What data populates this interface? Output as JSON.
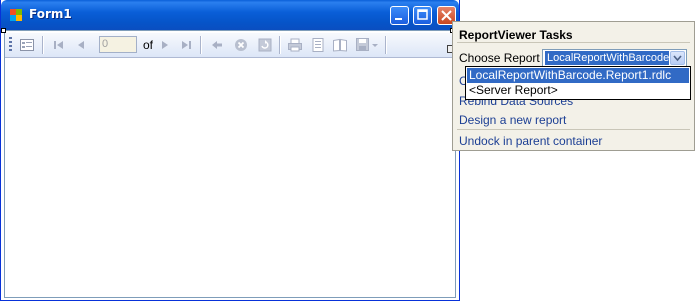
{
  "window": {
    "title": "Form1"
  },
  "toolbar": {
    "page_value": "0",
    "of_label": "of",
    "icons": [
      "document-map-icon",
      "first-page-icon",
      "previous-page-icon",
      "next-page-icon",
      "last-page-icon",
      "back-icon",
      "stop-icon",
      "refresh-icon",
      "print-icon",
      "print-layout-icon",
      "page-setup-icon",
      "export-icon"
    ]
  },
  "tasks": {
    "header": "ReportViewer Tasks",
    "choose_label": "Choose Report",
    "choose_value": "LocalReportWithBarcode.",
    "options": [
      "LocalReportWithBarcode.Report1.rdlc",
      "<Server Report>"
    ],
    "links": {
      "partial_top": "C",
      "rebind": "Rebind Data Sources",
      "design": "Design a new report",
      "undock": "Undock in parent container"
    }
  },
  "colors": {
    "title_bar": "#0a5fd8",
    "selection": "#316ac5",
    "link": "#1c3f94",
    "panel_bg": "#f3f1e8"
  }
}
